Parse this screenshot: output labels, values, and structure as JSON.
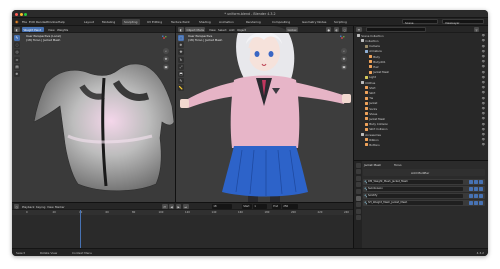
{
  "window": {
    "title": "* uniform.blend - Blender 4.3.2"
  },
  "menubar": {
    "items": [
      "File",
      "Edit",
      "Render",
      "Window",
      "Help"
    ],
    "workspaces": [
      "Layout",
      "Modeling",
      "Sculpting",
      "UV Editing",
      "Texture Paint",
      "Shading",
      "Animation",
      "Rendering",
      "Compositing",
      "Geometry Nodes",
      "Scripting"
    ],
    "active_workspace": "Sculpting",
    "scene": "Scene",
    "view_layer": "ViewLayer"
  },
  "left_viewport": {
    "mode": "Weight Paint",
    "menus": [
      "View",
      "Weights"
    ],
    "info_line1": "User Perspective (Local)",
    "info_line2": "(18) Torso | Jacket Mesh"
  },
  "right_viewport": {
    "mode": "Object Mode",
    "menus": [
      "View",
      "Select",
      "Add",
      "Object"
    ],
    "info_line1": "User Perspective",
    "info_line2": "(18) Torso | Jacket Mesh",
    "transform": "Global"
  },
  "timeline": {
    "menus": [
      "Playback",
      "Keying",
      "View",
      "Marker"
    ],
    "current_frame": "18",
    "start_label": "Start",
    "start": "1",
    "end_label": "End",
    "end": "250",
    "ticks": [
      "0",
      "20",
      "40",
      "60",
      "80",
      "100",
      "120",
      "140",
      "160",
      "180",
      "200",
      "220",
      "240"
    ]
  },
  "outliner": {
    "search_placeholder": "",
    "rows": [
      {
        "label": "Scene Collection",
        "indent": 0,
        "color": "#bdbdbd"
      },
      {
        "label": "Collection",
        "indent": 1,
        "color": "#bdbdbd"
      },
      {
        "label": "Camera",
        "indent": 2,
        "color": "#9d8e6a"
      },
      {
        "label": "Armature",
        "indent": 2,
        "color": "#8fb0d6"
      },
      {
        "label": "Body",
        "indent": 3,
        "color": "#f0a35a"
      },
      {
        "label": "Body.001",
        "indent": 3,
        "color": "#f0a35a"
      },
      {
        "label": "Hair",
        "indent": 3,
        "color": "#f0a35a"
      },
      {
        "label": "Jacket Mesh",
        "indent": 3,
        "color": "#f0a35a"
      },
      {
        "label": "Light",
        "indent": 2,
        "color": "#d6c95a"
      },
      {
        "label": "Clothes",
        "indent": 1,
        "color": "#bdbdbd"
      },
      {
        "label": "Shirt",
        "indent": 2,
        "color": "#f0a35a"
      },
      {
        "label": "Skirt",
        "indent": 2,
        "color": "#f0a35a"
      },
      {
        "label": "Tie",
        "indent": 2,
        "color": "#f0a35a"
      },
      {
        "label": "Jacket",
        "indent": 2,
        "color": "#f0a35a"
      },
      {
        "label": "Socks",
        "indent": 2,
        "color": "#f0a35a"
      },
      {
        "label": "Shoes",
        "indent": 2,
        "color": "#f0a35a"
      },
      {
        "label": "Jacket Mesh",
        "indent": 2,
        "color": "#f0a35a"
      },
      {
        "label": "Body Collision",
        "indent": 2,
        "color": "#f0a35a"
      },
      {
        "label": "Skirt Collision",
        "indent": 2,
        "color": "#f0a35a"
      },
      {
        "label": "Accessories",
        "indent": 1,
        "color": "#bdbdbd"
      },
      {
        "label": "Ribbon",
        "indent": 2,
        "color": "#f0a35a"
      },
      {
        "label": "Buttons",
        "indent": 2,
        "color": "#f0a35a"
      }
    ]
  },
  "properties": {
    "object_name": "Jacket Mesh",
    "data_name": "Torso",
    "panel_title": "Add Modifier",
    "modifiers": [
      {
        "name": "DM_Weight_Mesh_Jacket_Mesh"
      },
      {
        "name": "Subdivision"
      },
      {
        "name": "Solidify"
      },
      {
        "name": "SH_Weight_Mesh_Jacket_Mesh"
      }
    ]
  },
  "statusbar": {
    "left": "Select",
    "middle": "Rotate View",
    "right": "Context Menu",
    "version": "4.3.2"
  },
  "colors": {
    "accent": "#4772b3",
    "jacket_pink": "#e7b5c8",
    "skirt_blue": "#2d63c9"
  }
}
